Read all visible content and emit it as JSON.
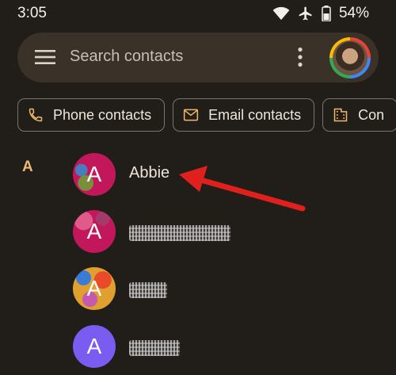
{
  "status_bar": {
    "time": "3:05",
    "battery": "54%",
    "icons": [
      "wifi-icon",
      "airplane-icon",
      "battery-icon"
    ]
  },
  "search": {
    "placeholder": "Search contacts",
    "icons": [
      "menu-icon",
      "more-vert-icon"
    ]
  },
  "chips": [
    {
      "label": "Phone contacts",
      "icon": "phone-icon"
    },
    {
      "label": "Email contacts",
      "icon": "mail-icon"
    },
    {
      "label": "Con",
      "icon": "building-icon"
    }
  ],
  "section": {
    "letter": "A"
  },
  "contacts": [
    {
      "initial": "A",
      "name": "Abbie",
      "name_visible": true,
      "color": "#c2185b"
    },
    {
      "initial": "A",
      "name": "",
      "name_visible": false,
      "color": "#c2185b"
    },
    {
      "initial": "A",
      "name": "",
      "name_visible": false,
      "color": "#e0a030"
    },
    {
      "initial": "A",
      "name": "",
      "name_visible": false,
      "color": "#7b5cf0"
    }
  ],
  "annotation": {
    "type": "arrow",
    "color": "#e0201c",
    "target": "Abbie"
  },
  "colors": {
    "background": "#211e1a",
    "search_bar": "#3a3128",
    "section_letter": "#f0b86c"
  }
}
